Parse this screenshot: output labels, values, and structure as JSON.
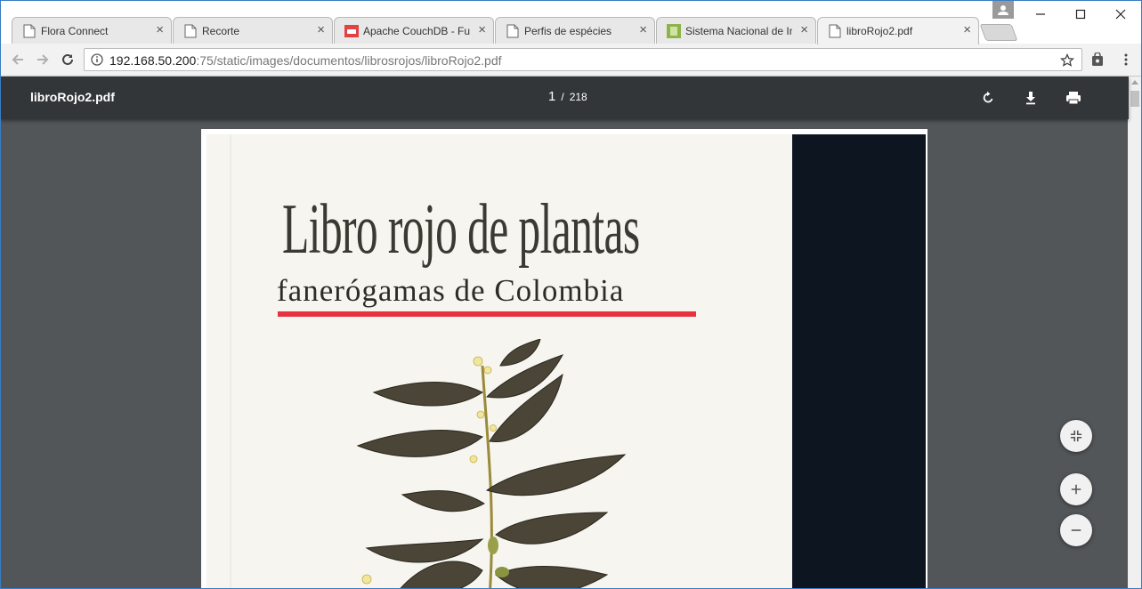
{
  "tabs": [
    {
      "title": "Flora Connect",
      "favicon": "page-icon"
    },
    {
      "title": "Recorte",
      "favicon": "page-icon"
    },
    {
      "title": "Apache CouchDB - Fut",
      "favicon": "couchdb-icon"
    },
    {
      "title": "Perfis de espécies",
      "favicon": "page-icon"
    },
    {
      "title": "Sistema Nacional de In",
      "favicon": "sib-icon"
    },
    {
      "title": "libroRojo2.pdf",
      "favicon": "page-icon",
      "active": true
    }
  ],
  "omnibox": {
    "host": "192.168.50.200",
    "path": ":75/static/images/documentos/librosrojos/libroRojo2.pdf"
  },
  "pdf": {
    "file_title": "libroRojo2.pdf",
    "current_page": "1",
    "separator": "/",
    "total_pages": "218"
  },
  "cover": {
    "title": "Libro rojo de plantas",
    "subtitle": "fanerógamas de Colombia"
  },
  "colors": {
    "pdf_toolbar": "#323639",
    "viewer_bg": "#525659",
    "red_rule": "#e8303f",
    "dark_band": "#0c1520"
  }
}
